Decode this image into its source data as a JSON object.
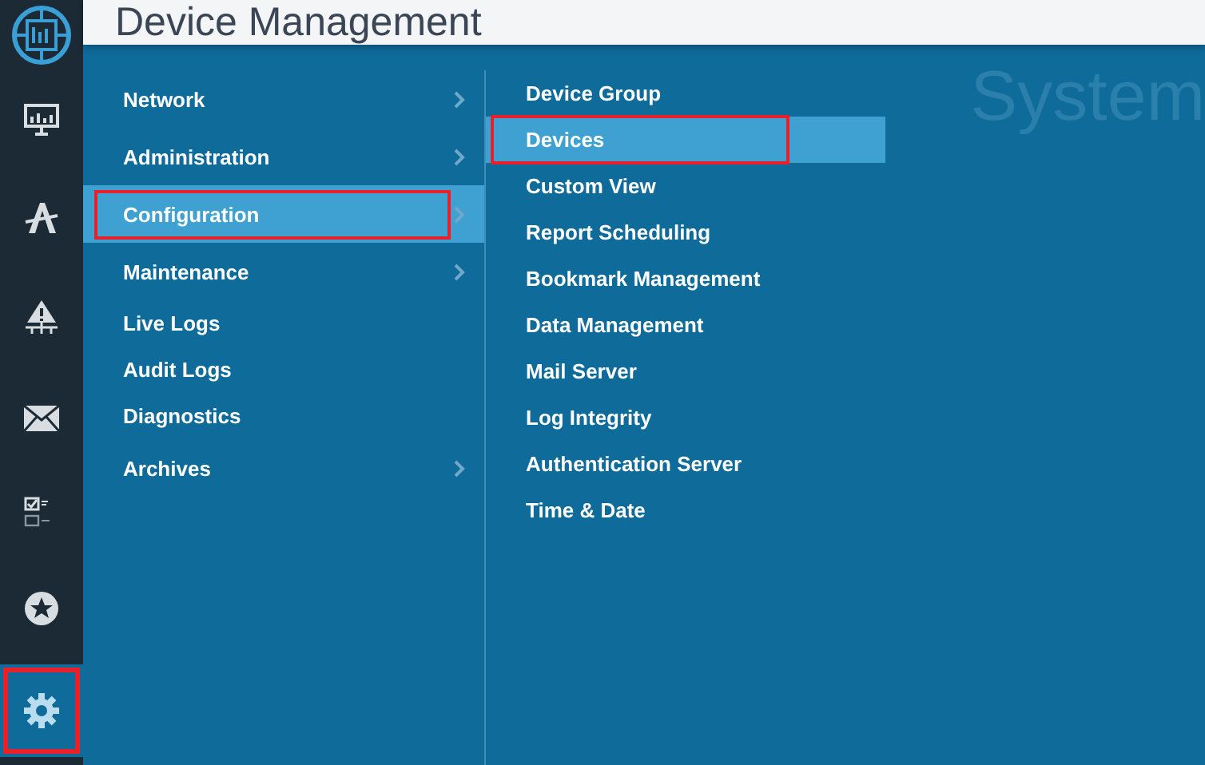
{
  "header": {
    "title": "Device Management"
  },
  "sidebar": {
    "items": [
      {
        "kind": "monitor",
        "selected": false,
        "highlighted": false
      },
      {
        "kind": "letter",
        "selected": false,
        "highlighted": false
      },
      {
        "kind": "warning",
        "selected": false,
        "highlighted": false
      },
      {
        "kind": "mail",
        "selected": false,
        "highlighted": false
      },
      {
        "kind": "checklist",
        "selected": false,
        "highlighted": false
      },
      {
        "kind": "star",
        "selected": false,
        "highlighted": false
      },
      {
        "kind": "gear",
        "selected": true,
        "highlighted": true
      }
    ]
  },
  "background_heading": "System",
  "menu": {
    "items": [
      {
        "label": "Network",
        "submenu": true,
        "selected": false,
        "highlighted": false
      },
      {
        "label": "Administration",
        "submenu": true,
        "selected": false,
        "highlighted": false
      },
      {
        "label": "Configuration",
        "submenu": true,
        "selected": true,
        "highlighted": true
      },
      {
        "label": "Maintenance",
        "submenu": true,
        "selected": false,
        "highlighted": false
      },
      {
        "label": "Live Logs",
        "submenu": false,
        "selected": false,
        "highlighted": false
      },
      {
        "label": "Audit Logs",
        "submenu": false,
        "selected": false,
        "highlighted": false
      },
      {
        "label": "Diagnostics",
        "submenu": false,
        "selected": false,
        "highlighted": false
      },
      {
        "label": "Archives",
        "submenu": true,
        "selected": false,
        "highlighted": false
      }
    ]
  },
  "submenu": {
    "items": [
      {
        "label": "Device Group",
        "selected": false,
        "highlighted": false
      },
      {
        "label": "Devices",
        "selected": true,
        "highlighted": true
      },
      {
        "label": "Custom View",
        "selected": false,
        "highlighted": false
      },
      {
        "label": "Report Scheduling",
        "selected": false,
        "highlighted": false
      },
      {
        "label": "Bookmark Management",
        "selected": false,
        "highlighted": false
      },
      {
        "label": "Data Management",
        "selected": false,
        "highlighted": false
      },
      {
        "label": "Mail Server",
        "selected": false,
        "highlighted": false
      },
      {
        "label": "Log Integrity",
        "selected": false,
        "highlighted": false
      },
      {
        "label": "Authentication Server",
        "selected": false,
        "highlighted": false
      },
      {
        "label": "Time & Date",
        "selected": false,
        "highlighted": false
      }
    ]
  }
}
